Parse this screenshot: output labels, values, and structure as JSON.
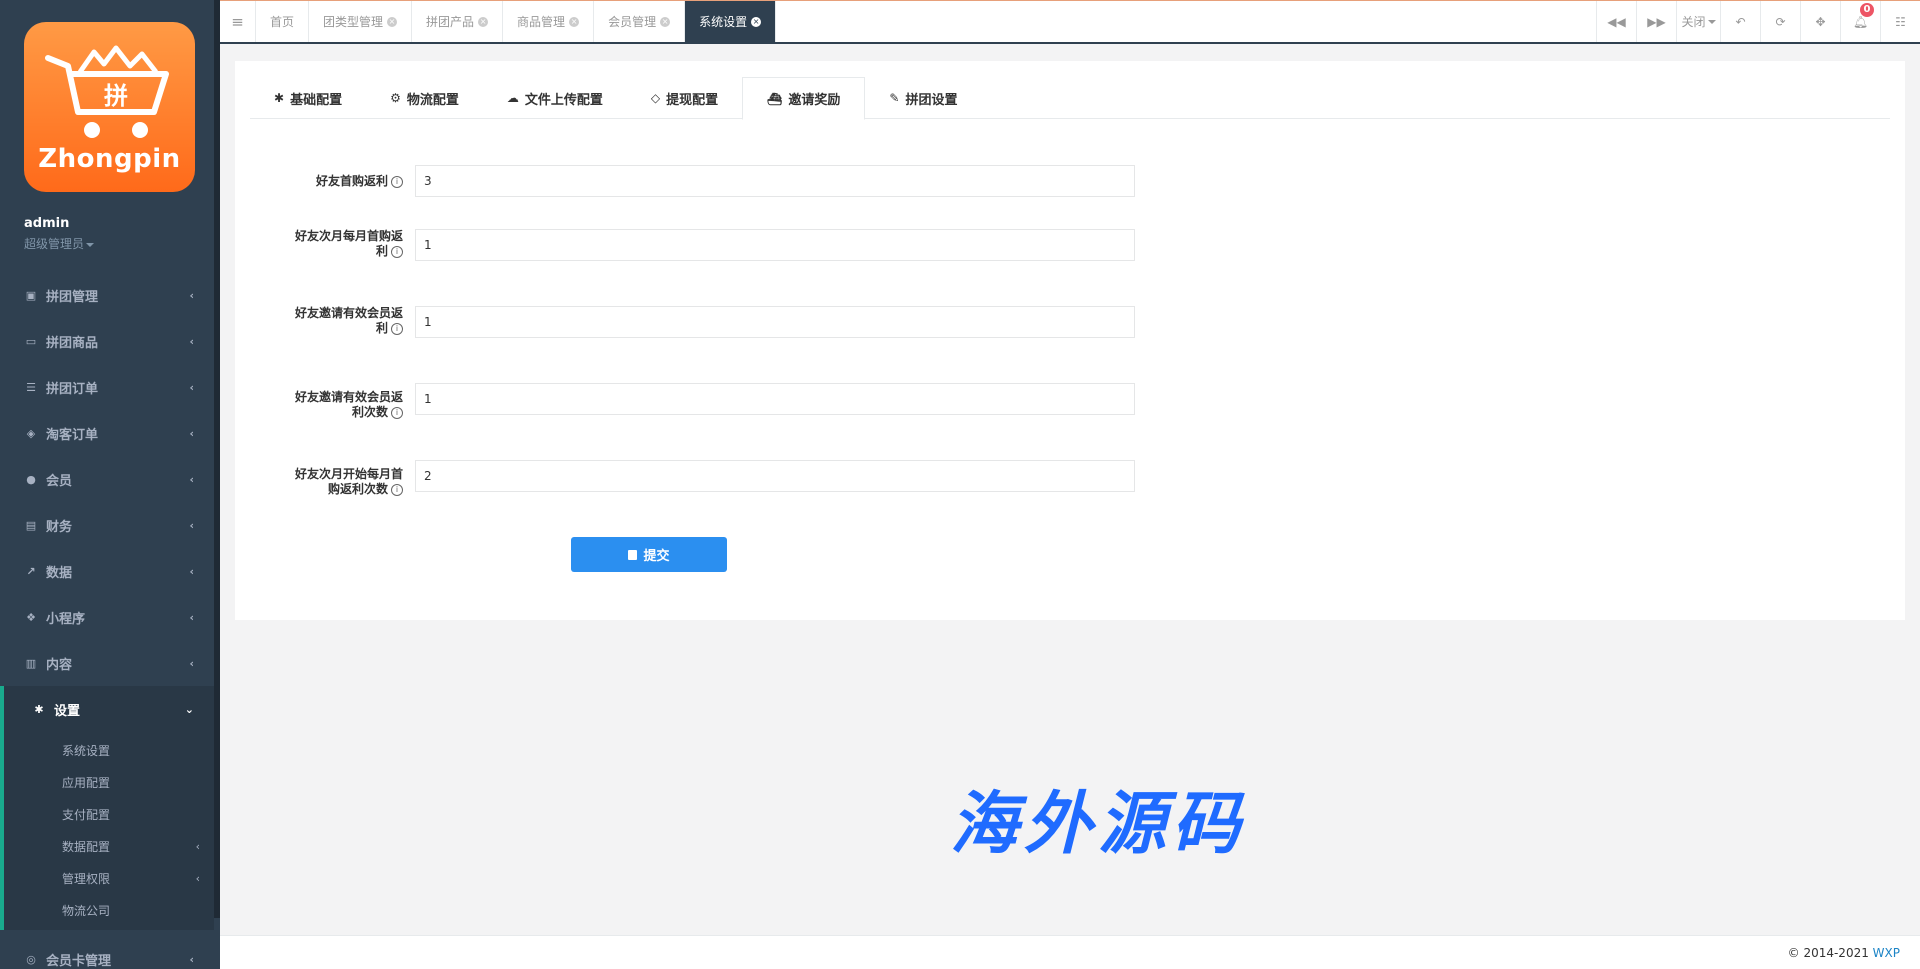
{
  "brand": {
    "logo_text": "Zhongpin",
    "logo_mark": "拼"
  },
  "profile": {
    "name": "admin",
    "role": "超级管理员"
  },
  "sidebar": {
    "items": [
      {
        "label": "拼团管理",
        "icon": "train-icon"
      },
      {
        "label": "拼团商品",
        "icon": "laptop-icon"
      },
      {
        "label": "拼团订单",
        "icon": "list-icon"
      },
      {
        "label": "淘客订单",
        "icon": "cube-icon"
      },
      {
        "label": "会员",
        "icon": "user-icon"
      },
      {
        "label": "财务",
        "icon": "money-icon"
      },
      {
        "label": "数据",
        "icon": "chart-icon"
      },
      {
        "label": "小程序",
        "icon": "cubes-icon"
      },
      {
        "label": "内容",
        "icon": "book-icon"
      }
    ],
    "active": {
      "label": "设置",
      "icon": "gear-icon"
    },
    "sub_items": [
      {
        "label": "系统设置"
      },
      {
        "label": "应用配置"
      },
      {
        "label": "支付配置"
      },
      {
        "label": "数据配置"
      },
      {
        "label": "管理权限"
      },
      {
        "label": "物流公司"
      }
    ],
    "after": {
      "label": "会员卡管理",
      "icon": "card-icon"
    }
  },
  "topbar": {
    "tabs": [
      {
        "label": "首页"
      },
      {
        "label": "团类型管理"
      },
      {
        "label": "拼团产品"
      },
      {
        "label": "商品管理"
      },
      {
        "label": "会员管理"
      },
      {
        "label": "系统设置"
      }
    ],
    "close_label": "关闭",
    "notification_count": "0"
  },
  "panel_tabs": [
    {
      "label": "基础配置",
      "icon": "gear-icon"
    },
    {
      "label": "物流配置",
      "icon": "motorcycle-icon"
    },
    {
      "label": "文件上传配置",
      "icon": "cloud-upload-icon"
    },
    {
      "label": "提现配置",
      "icon": "diamond-icon"
    },
    {
      "label": "邀请奖励",
      "icon": "ship-icon"
    },
    {
      "label": "拼团设置",
      "icon": "paint-brush-icon"
    }
  ],
  "form": {
    "fields": [
      {
        "label_line1": "好友首购返利",
        "label_line2": "",
        "value": "3"
      },
      {
        "label_line1": "好友次月每月首购返",
        "label_line2": "利",
        "value": "1"
      },
      {
        "label_line1": "好友邀请有效会员返",
        "label_line2": "利",
        "value": "1"
      },
      {
        "label_line1": "好友邀请有效会员返",
        "label_line2": "利次数",
        "value": "1"
      },
      {
        "label_line1": "好友次月开始每月首",
        "label_line2": "购返利次数",
        "value": "2"
      }
    ],
    "submit_label": "提交"
  },
  "watermark": "海外源码",
  "footer": {
    "copyright": "© 2014-2021 ",
    "link": "WXP"
  }
}
